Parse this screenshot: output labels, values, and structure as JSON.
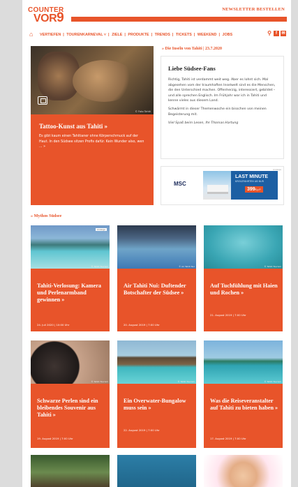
{
  "header": {
    "logo_top": "COUNTER",
    "logo_bottom": "VOR",
    "logo_nine": "9",
    "newsletter_link": "NEWSLETTER BESTELLEN"
  },
  "nav": {
    "items": [
      "VERTIEFEN",
      "TOURENKARNEVAL ˅",
      "ZIELE",
      "PRODUKTE",
      "TRENDS",
      "TICKETS",
      "WEEKEND",
      "JOBS"
    ]
  },
  "hero": {
    "title": "Tattoo-Kunst aus Tahiti »",
    "text": "Es gibt kaum einen Tahitianer ohne Körperschmuck auf der Haut. In den Südsee sitzen Profis dafür. Kein Wunder also, wen ... »",
    "credit": "© Foto Tahiti"
  },
  "issue": {
    "date_line": "» Die Inseln von Tahiti | 23.7.2020"
  },
  "letter": {
    "title": "Liebe Südsee-Fans",
    "p1": "Richtig, Tahiti ist verdammt weit weg. Aber es lohnt sich. Mal abgesehen vom der traumhaften Inselwelt sind es die Menschen, die den Unterschied machen. Offenherzig, interessiert, gebildet – und alle sprechen Englisch. Im Frühjahr war ich in Tahiti und kenne vieles aus diesem Land.",
    "p2": "Schwärmt in dieser Themenwoche ein bisschen von meinen Begeisterung mit.",
    "signature": "Viel Spaß beim Lesen, Ihr Thomas Hartung"
  },
  "ad": {
    "label": "Anzeige",
    "brand": "MSC",
    "headline": "LAST MINUTE",
    "sub": "KREUZFAHRTEN AB NUR",
    "price": "399",
    "price_suffix": "€ p.P."
  },
  "section": {
    "title": "» Mythos Südsee"
  },
  "cards": [
    {
      "title": "Tahiti-Verlosung: Kamera und Perlenarmband gewinnen »",
      "date": "24. Juli 2020 | 10:00 Uhr",
      "credit": "© Tahiti Tourism",
      "badge": "Anzeige"
    },
    {
      "title": "Air Tahiti Nui: Duftender Botschafter der Südsee »",
      "date": "20. August 2019 | 7:00 Uhr",
      "credit": "© Air Tahiti Nui"
    },
    {
      "title": "Auf Tuchfühlung mit Haien und Rochen »",
      "date": "21. August 2019 | 7:00 Uhr",
      "credit": "© Tahiti Tourism"
    },
    {
      "title": "Schwarze Perlen sind ein bleibendes Souvenir aus Tahiti »",
      "date": "19. August 2019 | 7:00 Uhr",
      "credit": "© Tahiti Tourism"
    },
    {
      "title": "Ein Overwater-Bungalow muss sein »",
      "date": "22. August 2019 | 7:00 Uhr",
      "credit": "© Tahiti Tourism"
    },
    {
      "title": "Was die Reiseveranstalter auf Tahiti zu bieten haben »",
      "date": "17. August 2019 | 7:00 Uhr",
      "credit": "© Tahiti Tourism"
    }
  ]
}
